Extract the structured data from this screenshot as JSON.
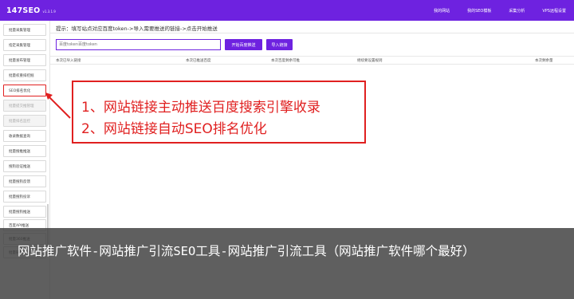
{
  "app": {
    "name": "147SEO",
    "version": "v1.3.1.9"
  },
  "topnav": [
    "我的网站",
    "我的SEO模板",
    "采集分析",
    "VPS远程设置"
  ],
  "sidebar": [
    {
      "label": "批量采集管理"
    },
    {
      "label": "指定采集管理"
    },
    {
      "label": "批量发布管理"
    },
    {
      "label": "批量权重排挖掘"
    },
    {
      "label": "SEO排名优化",
      "selected": true
    },
    {
      "label": "批量提交推管理",
      "disabled": true
    },
    {
      "label": "批量排名监控",
      "disabled": true
    },
    {
      "label": "收录数据查询"
    },
    {
      "label": "批量搜推推送"
    },
    {
      "label": "搜狗验证推送"
    },
    {
      "label": "批量搜狗反馈"
    },
    {
      "label": "批量搜狗投诉"
    },
    {
      "label": "批量搜狗推送"
    },
    {
      "label": "百度API推送"
    },
    {
      "label": "批量360推送"
    },
    {
      "label": "批量链接工具"
    }
  ],
  "main": {
    "tip": "提示：填写站点对应百度token->导入需要推送的链接->点击开始推送",
    "token_placeholder": "百度token百度token",
    "start_button": "开始百度推送",
    "import_button": "导入链接",
    "columns": [
      "本次已导入链接",
      "本次已推送百度",
      "本次百度剩余可推",
      "继续要设置规则",
      "本次剩余量"
    ]
  },
  "annotation": {
    "line1": "1、网站链接主动推送百度搜索引擎收录",
    "line2": "2、网站链接自动SEO排名优化"
  },
  "overlay": {
    "caption": "网站推广软件-网站推广引流SEO工具-网站推广引流工具（网站推广软件哪个最好）"
  },
  "colors": {
    "accent": "#6e22e0",
    "annotation": "#e02020"
  }
}
